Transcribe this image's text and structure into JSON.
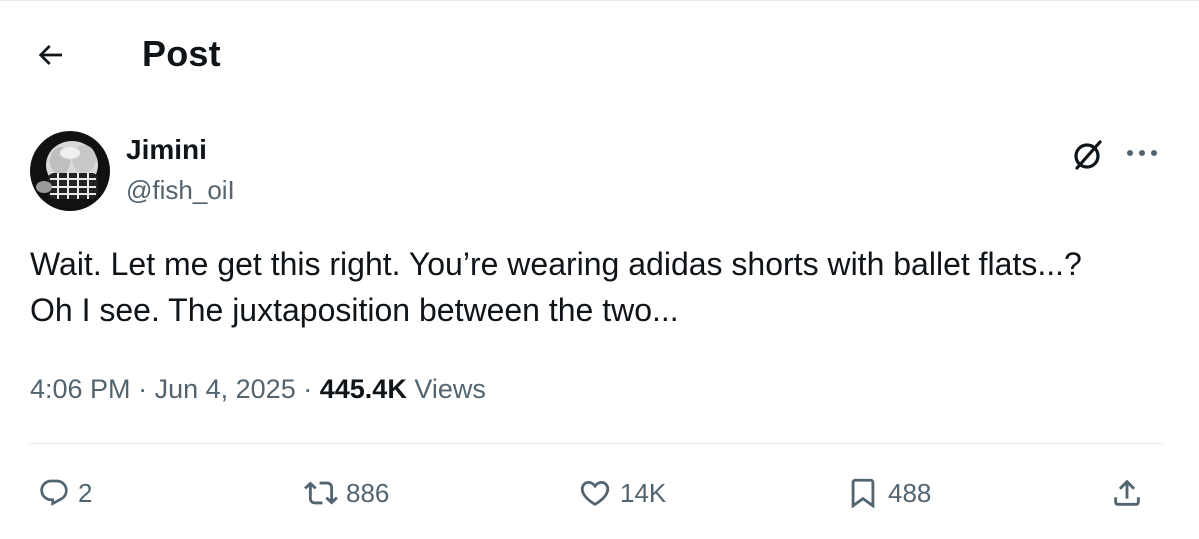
{
  "header": {
    "title": "Post",
    "back_icon": "arrow-left-icon"
  },
  "author": {
    "display_name": "Jimini",
    "handle": "@fish_oiI",
    "avatar_icon": "avatar"
  },
  "tweet": {
    "text": "Wait. Let me get this right. You’re wearing adidas shorts with ballet flats...? Oh I see. The juxtaposition between the two..."
  },
  "meta": {
    "time": "4:06 PM",
    "separator": "·",
    "date": "Jun 4, 2025",
    "views_count": "445.4K",
    "views_label": "Views"
  },
  "actions": {
    "reply_count": "2",
    "retweet_count": "886",
    "like_count": "14K",
    "bookmark_count": "488"
  },
  "colors": {
    "text": "#0f1419",
    "secondary": "#536471",
    "divider": "#e6e9eb"
  }
}
